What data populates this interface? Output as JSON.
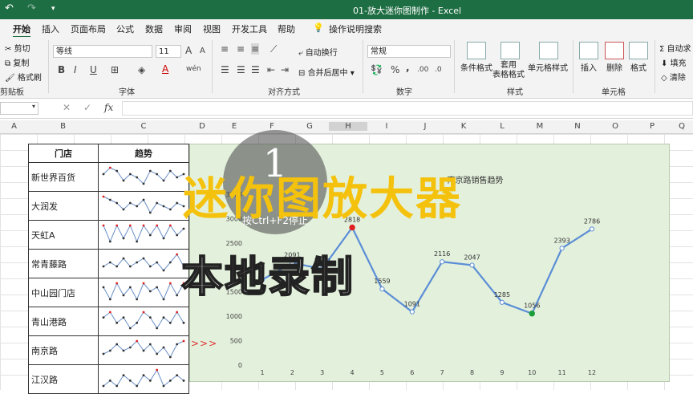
{
  "window": {
    "title": "01-放大迷你图制作 - Excel"
  },
  "tabs": [
    "开始",
    "插入",
    "页面布局",
    "公式",
    "数据",
    "审阅",
    "视图",
    "开发工具",
    "帮助"
  ],
  "tell_me": "操作说明搜索",
  "ribbon": {
    "clipboard": {
      "cut": "剪切",
      "copy": "复制",
      "format_painter": "格式刷",
      "group": "剪贴板"
    },
    "font": {
      "name": "等线",
      "size": "11",
      "bold": "B",
      "italic": "I",
      "underline": "U",
      "group": "字体",
      "grow": "A",
      "shrink": "A",
      "wen": "wén"
    },
    "alignment": {
      "wrap": "自动换行",
      "merge": "合并后居中",
      "group": "对齐方式"
    },
    "number": {
      "format": "常规",
      "group": "数字",
      "percent": "%",
      "comma": ",",
      "inc_decimal": ".00",
      "dec_decimal": ".0"
    },
    "styles": {
      "conditional": "条件格式",
      "table": "套用\n表格格式",
      "cell_styles": "单元格样式",
      "group": "样式"
    },
    "cells": {
      "insert": "插入",
      "delete": "删除",
      "format": "格式",
      "group": "单元格"
    },
    "editing": {
      "sum": "Σ 自动求",
      "fill": "填充",
      "clear": "清除"
    }
  },
  "formula_bar": {
    "name_box": "",
    "fx": "fx",
    "cancel": "✕",
    "enter": "✓"
  },
  "columns": [
    "A",
    "B",
    "C",
    "D",
    "E",
    "F",
    "G",
    "H",
    "I",
    "J",
    "K",
    "L",
    "M",
    "N",
    "O",
    "P",
    "Q"
  ],
  "selected_column": "H",
  "table": {
    "headers": [
      "门店",
      "趋势"
    ],
    "stores": [
      "新世界百货",
      "大润发",
      "天虹A",
      "常青藤路",
      "中山园门店",
      "青山港路",
      "南京路",
      "江汉路"
    ],
    "sparklines": [
      [
        5,
        7,
        6,
        3,
        5,
        4,
        2,
        6,
        5,
        3,
        6,
        4,
        5
      ],
      [
        6,
        5,
        4,
        2,
        4,
        3,
        5,
        1,
        4,
        3,
        2,
        4,
        3
      ],
      [
        6,
        1,
        6,
        2,
        6,
        1,
        6,
        3,
        6,
        2,
        6,
        3,
        5
      ],
      [
        3,
        4,
        3,
        5,
        3,
        4,
        5,
        3,
        4,
        2,
        4,
        6,
        3
      ],
      [
        5,
        2,
        6,
        3,
        5,
        2,
        6,
        4,
        5,
        2,
        6,
        3,
        6
      ],
      [
        4,
        5,
        3,
        4,
        2,
        3,
        5,
        4,
        2,
        4,
        3,
        5,
        3
      ],
      [
        2,
        3,
        5,
        3,
        4,
        6,
        3,
        5,
        2,
        4,
        1,
        5,
        6
      ],
      [
        3,
        4,
        3,
        5,
        4,
        3,
        5,
        4,
        6,
        3,
        4,
        5,
        4
      ]
    ],
    "arrows": ">>>"
  },
  "chart_data": {
    "type": "line",
    "title": "南京路销售趋势",
    "x": [
      1,
      2,
      3,
      4,
      5,
      6,
      7,
      8,
      9,
      10,
      11,
      12
    ],
    "series": [
      {
        "name": "南京路",
        "values": [
          1750,
          2091,
          1972,
          2818,
          1559,
          1091,
          2116,
          2047,
          1285,
          1056,
          2393,
          2786
        ]
      }
    ],
    "data_labels": [
      "",
      "2091",
      "1972",
      "2818",
      "1559",
      "1091",
      "2116",
      "2047",
      "1285",
      "1056",
      "2393",
      "2786"
    ],
    "ylim": [
      0,
      3500
    ],
    "yticks": [
      0,
      500,
      1000,
      1500,
      2000,
      2500,
      3000,
      3500
    ],
    "line_color": "#5b8ed6",
    "max_point_color": "#e02020",
    "min_point_color": "#1a9e3a",
    "background": "#e3f0dc"
  },
  "overlay": {
    "headline": "迷你图放大器",
    "subline": "本地录制",
    "countdown": "1",
    "hint": "按Ctrl+F2停止"
  }
}
